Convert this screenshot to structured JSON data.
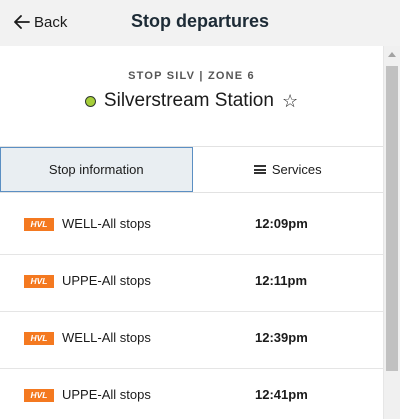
{
  "header": {
    "back_label": "Back",
    "title": "Stop departures"
  },
  "stop": {
    "meta": "STOP SILV | ZONE 6",
    "name": "Silverstream Station",
    "dot_color": "#a6ce39",
    "favorite_icon": "star-outline-icon"
  },
  "tabs": [
    {
      "label": "Stop information",
      "active": true
    },
    {
      "label": "Services",
      "icon": "list-icon",
      "active": false
    }
  ],
  "departures": [
    {
      "operator": "HVL",
      "service": "WELL-All stops",
      "time": "12:09pm"
    },
    {
      "operator": "HVL",
      "service": "UPPE-All stops",
      "time": "12:11pm"
    },
    {
      "operator": "HVL",
      "service": "WELL-All stops",
      "time": "12:39pm"
    },
    {
      "operator": "HVL",
      "service": "UPPE-All stops",
      "time": "12:41pm"
    }
  ],
  "colors": {
    "badge": "#f47920",
    "active_tab_border": "#5b8fc3"
  }
}
